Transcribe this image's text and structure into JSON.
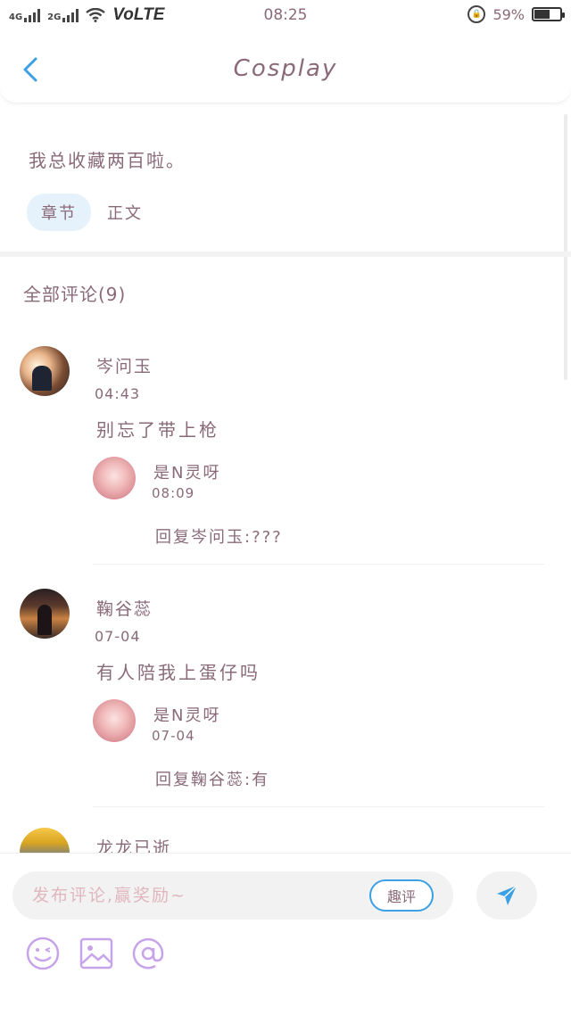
{
  "status_bar": {
    "net_4g": "4G",
    "net_2g": "2G",
    "volte": "VoLTE",
    "time": "08:25",
    "battery_pct": "59%",
    "battery_level": 0.59
  },
  "header": {
    "title": "Cosplay"
  },
  "intro": {
    "text": "我总收藏两百啦。",
    "chip_label": "章节",
    "plain_label": "正文"
  },
  "comments_header": "全部评论(9)",
  "comments": [
    {
      "name": "岑问玉",
      "time": "04:43",
      "text": "别忘了带上枪",
      "reply": {
        "name": "是N灵呀",
        "time": "08:09",
        "text": "回复岑问玉:???"
      }
    },
    {
      "name": "鞠谷蕊",
      "time": "07-04",
      "text": "有人陪我上蛋仔吗",
      "reply": {
        "name": "是N灵呀",
        "time": "07-04",
        "text": "回复鞠谷蕊:有"
      }
    },
    {
      "name": "龙龙已逝"
    }
  ],
  "input": {
    "placeholder": "发布评论,赢奖励~",
    "quick_comment": "趣评"
  },
  "colors": {
    "text": "#8a6a78",
    "accent_blue": "#3ba0e6",
    "chip_bg": "#e5f2fb",
    "tool_purple": "#c7a4ea"
  }
}
